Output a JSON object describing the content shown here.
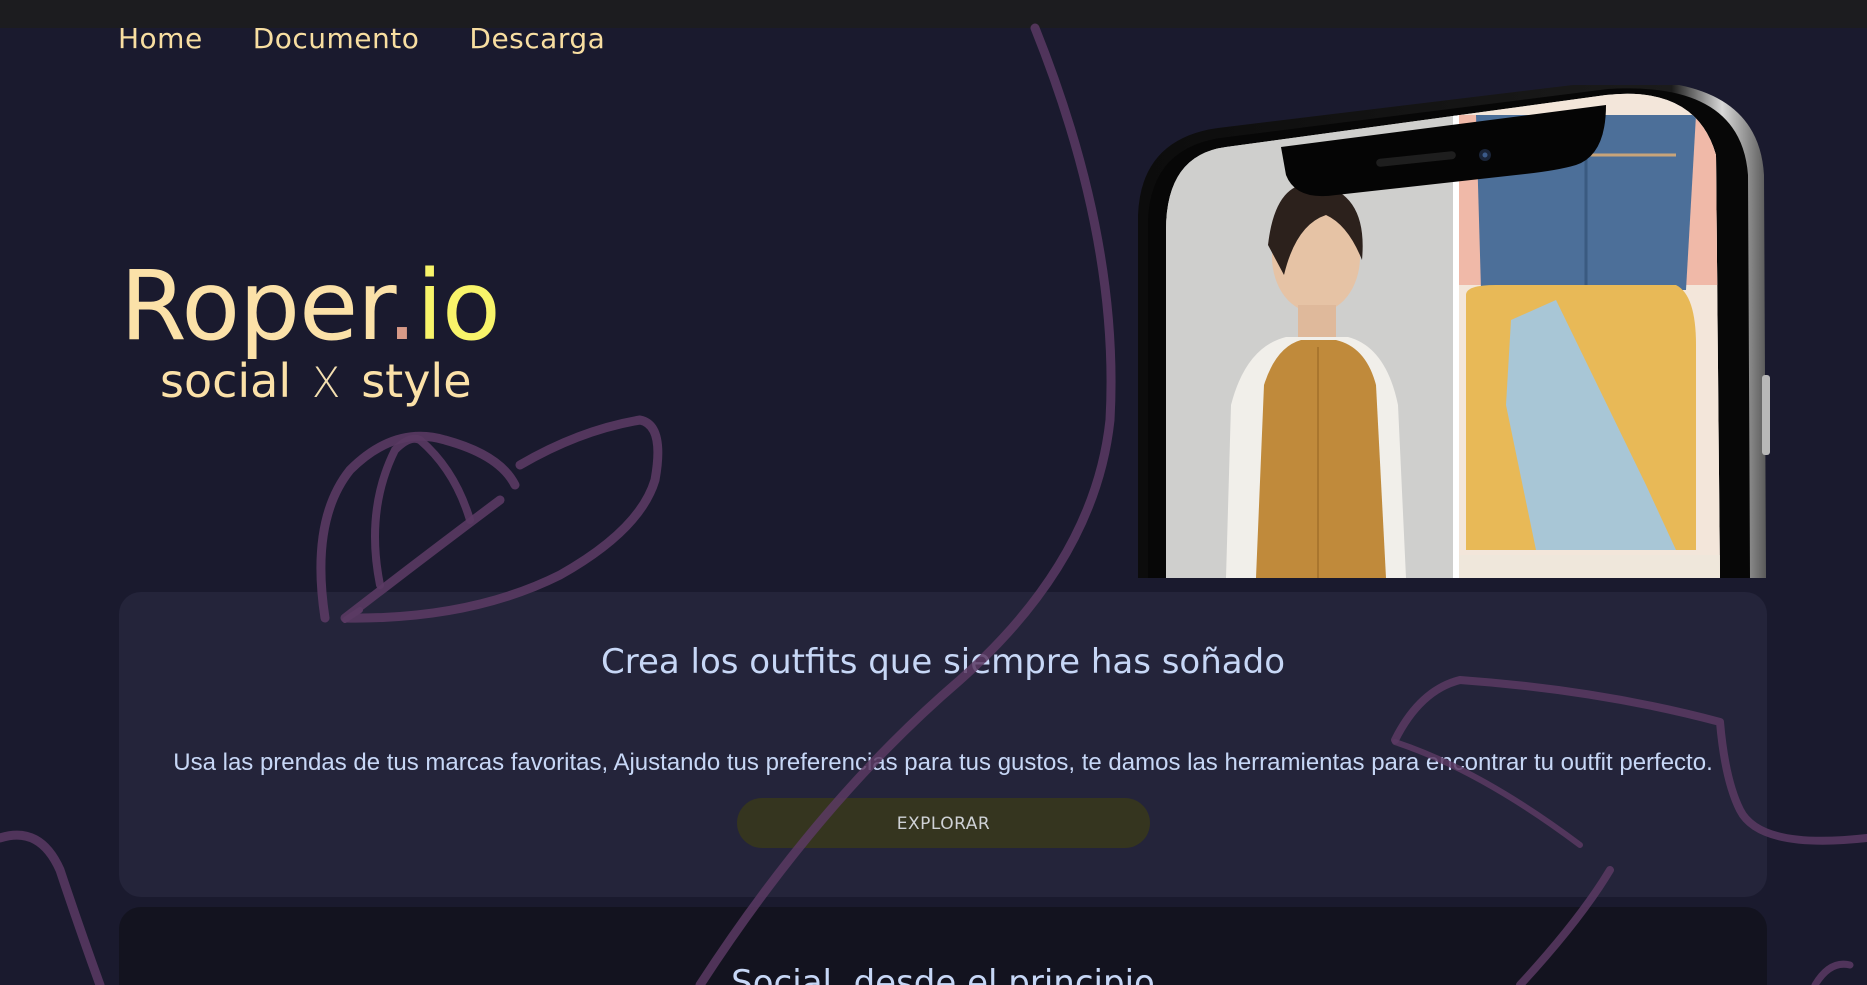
{
  "nav": {
    "items": [
      {
        "label": "Home"
      },
      {
        "label": "Documento"
      },
      {
        "label": "Descarga"
      }
    ]
  },
  "brand": {
    "name_main": "Roper",
    "name_dot": ".",
    "name_tld": "io",
    "tagline_left": "social",
    "tagline_x": "X",
    "tagline_right": "style"
  },
  "hero_card": {
    "heading": "Crea los outfits que siempre has soñado",
    "body": "Usa las prendas de tus marcas favoritas, Ajustando tus preferencias para tus gustos, te damos las herramientas para encontrar tu outfit perfecto.",
    "cta_label": "EXPLORAR"
  },
  "second_card": {
    "heading": "Social, desde el principio"
  },
  "colors": {
    "background": "#1a1a2e",
    "brand_yellow": "#fbe1a8",
    "accent_lime": "#f8f46a",
    "accent_dot": "#d89a88",
    "heading_blue": "#c7d7f6",
    "swirl": "#5a3a63"
  }
}
